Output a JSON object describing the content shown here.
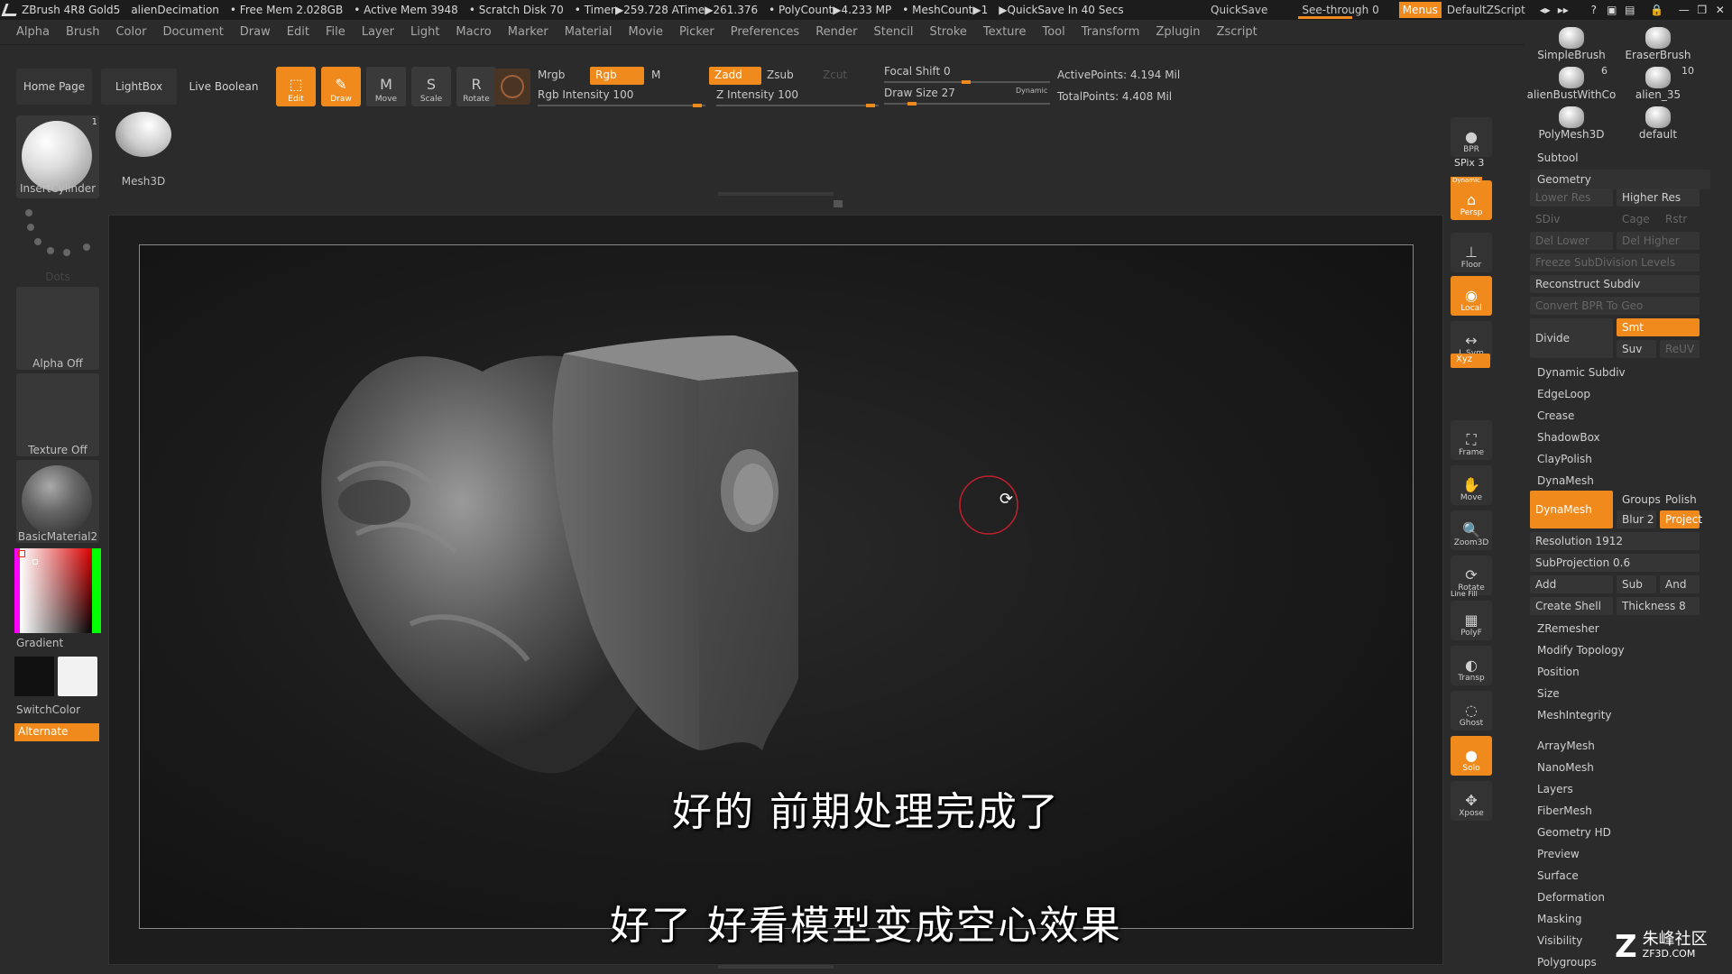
{
  "titlebar": {
    "app": "ZBrush 4R8 Gold5",
    "project": "alienDecimation",
    "free_mem": "• Free Mem 2.028GB",
    "active_mem": "• Active Mem 3948",
    "scratch": "• Scratch Disk 70",
    "timer": "• Timer▶259.728 ATime▶261.376",
    "polycount": "• PolyCount▶4.233 MP",
    "meshcount": "• MeshCount▶1",
    "quicksave_in": "▶QuickSave In 40 Secs",
    "quicksave": "QuickSave",
    "see_through": "See-through  0",
    "menus": "Menus",
    "zscript": "DefaultZScript"
  },
  "menubar": [
    "Alpha",
    "Brush",
    "Color",
    "Document",
    "Draw",
    "Edit",
    "File",
    "Layer",
    "Light",
    "Macro",
    "Marker",
    "Material",
    "Movie",
    "Picker",
    "Preferences",
    "Render",
    "Stencil",
    "Stroke",
    "Texture",
    "Tool",
    "Transform",
    "Zplugin",
    "Zscript"
  ],
  "shelf": {
    "home_page": "Home Page",
    "lightbox": "LightBox",
    "live_boolean": "Live Boolean",
    "tools": [
      {
        "label": "Edit",
        "glyph": "⬚",
        "active": true
      },
      {
        "label": "Draw",
        "glyph": "✎",
        "active": true
      },
      {
        "label": "Move",
        "glyph": "M",
        "active": false
      },
      {
        "label": "Scale",
        "glyph": "S",
        "active": false
      },
      {
        "label": "Rotate",
        "glyph": "R",
        "active": false
      }
    ],
    "mrgb": "Mrgb",
    "rgb": "Rgb",
    "m": "M",
    "zadd": "Zadd",
    "zsub": "Zsub",
    "zcut": "Zcut",
    "rgb_intensity": "Rgb Intensity 100",
    "z_intensity": "Z Intensity 100",
    "focal_shift": "Focal Shift 0",
    "draw_size": "Draw Size 27",
    "dynamic": "Dynamic",
    "active_points": "ActivePoints: 4.194 Mil",
    "total_points": "TotalPoints: 4.408 Mil"
  },
  "leftpanel": {
    "badge": "1",
    "insert_cylinder": "InsertCylinder",
    "mesh3d": "Mesh3D",
    "dots": "Dots",
    "alpha_off": "Alpha Off",
    "texture_off": "Texture Off",
    "material": "BasicMaterial2",
    "gradient": "Gradient",
    "switch_color": "SwitchColor",
    "alternate": "Alternate"
  },
  "rightshelf": [
    {
      "label": "BPR",
      "glyph": "●",
      "active": false
    },
    {
      "label": "Persp",
      "glyph": "⌂",
      "active": true
    },
    {
      "label": "Floor",
      "glyph": "⊥",
      "active": false
    },
    {
      "label": "Local",
      "glyph": "◉",
      "active": true
    },
    {
      "label": "L.Sym",
      "glyph": "↔",
      "active": false
    },
    {
      "label": "Frame",
      "glyph": "⛶",
      "active": false
    },
    {
      "label": "Move",
      "glyph": "✋",
      "active": false
    },
    {
      "label": "Zoom3D",
      "glyph": "🔍",
      "active": false
    },
    {
      "label": "Rotate",
      "glyph": "⟳",
      "active": false
    },
    {
      "label": "PolyF",
      "glyph": "▦",
      "active": false
    },
    {
      "label": "Transp",
      "glyph": "◐",
      "active": false
    },
    {
      "label": "Ghost",
      "glyph": "◌",
      "active": false
    },
    {
      "label": "Solo",
      "glyph": "●",
      "active": true
    },
    {
      "label": "Xpose",
      "glyph": "✥",
      "active": false
    }
  ],
  "rightshelf_extra": {
    "spix": "SPix 3",
    "xyz": "Xyz",
    "linefill": "Line Fill",
    "dyn": "Dynamic"
  },
  "rightpanel": {
    "brushes": [
      {
        "name": "SimpleBrush",
        "count": ""
      },
      {
        "name": "EraserBrush",
        "count": ""
      },
      {
        "name": "alienBustWithCo",
        "count": "6"
      },
      {
        "name": "alien_35",
        "count": "10"
      },
      {
        "name": "PolyMesh3D",
        "count": ""
      },
      {
        "name": "default",
        "count": ""
      }
    ],
    "subtool": "Subtool",
    "geometry": "Geometry",
    "lower_res": "Lower Res",
    "higher_res": "Higher Res",
    "sdiv": "SDiv",
    "cage": "Cage",
    "rstr": "Rstr",
    "del_lower": "Del Lower",
    "del_higher": "Del Higher",
    "freeze": "Freeze SubDivision Levels",
    "reconstruct": "Reconstruct Subdiv",
    "convert_bpr": "Convert BPR To Geo",
    "divide": "Divide",
    "smt": "Smt",
    "suv": "Suv",
    "reuv": "ReUV",
    "dynamic_subdiv": "Dynamic Subdiv",
    "edgeloop": "EdgeLoop",
    "crease": "Crease",
    "shadowbox": "ShadowBox",
    "claypolish": "ClayPolish",
    "dynamesh_header": "DynaMesh",
    "dynamesh_btn": "DynaMesh",
    "groups": "Groups",
    "polish": "Polish",
    "blur": "Blur 2",
    "project": "Project",
    "resolution": "Resolution 1912",
    "subprojection": "SubProjection 0.6",
    "add": "Add",
    "sub": "Sub",
    "and": "And",
    "create_shell": "Create Shell",
    "thickness": "Thickness 8",
    "zremesher": "ZRemesher",
    "modify_topology": "Modify Topology",
    "position": "Position",
    "size": "Size",
    "mesh_integrity": "MeshIntegrity",
    "sections": [
      "ArrayMesh",
      "NanoMesh",
      "Layers",
      "FiberMesh",
      "Geometry HD",
      "Preview",
      "Surface",
      "Deformation",
      "Masking",
      "Visibility",
      "Polygroups"
    ]
  },
  "subtitles": {
    "line1": "好的 前期处理完成了",
    "line2": "好了 好看模型变成空心效果"
  },
  "watermark": {
    "brand": "朱峰社区",
    "url": "ZF3D.COM"
  },
  "colors": {
    "accent": "#f08a1c",
    "bg": "#2b2b2b",
    "cursor_ring": "#c0202a"
  }
}
